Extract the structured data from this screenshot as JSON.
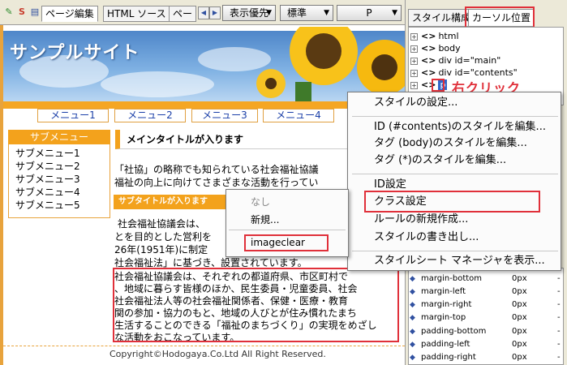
{
  "toolbar": {
    "icons": [
      "pencil-icon",
      "s-icon",
      "document-icon"
    ],
    "tabs": [
      "ページ編集",
      "HTML ソース",
      "ペー"
    ],
    "dropdowns": [
      "表示優先",
      "標準",
      "P"
    ]
  },
  "page": {
    "site_title": "サンプルサイト",
    "menus": [
      "メニュー1",
      "メニュー2",
      "メニュー3",
      "メニュー4"
    ],
    "submenu_title": "サブメニュー",
    "submenu_items": [
      "サブメニュー1",
      "サブメニュー2",
      "サブメニュー3",
      "サブメニュー4",
      "サブメニュー5"
    ],
    "main_title": "メインタイトルが入ります",
    "intro_lines": [
      "「社協」の略称でも知られている社会福祉協議",
      "福祉の向上に向けてさまざまな活動を行ってい"
    ],
    "subtitle": "サブタイトルが入ります",
    "para1": [
      "社会福祉協議会は、",
      "とを目的とした営利を",
      "26年(1951年)に制定",
      "社会福祉法」に基づき、設置されています。"
    ],
    "para2": [
      "社会福祉協議会は、それぞれの都道府県、市区町村で",
      "、地域に暮らす皆様のほか、民生委員・児童委員、社会",
      "社会福祉法人等の社会福祉関係者、保健・医療・教育",
      "関の参加・協力のもと、地域の人びとが住み慣れたまち",
      "生活することのできる「福祉のまちづくり」の実現をめざし",
      "な活動をおこなっています。"
    ],
    "copyright": "Copyright©Hodogaya.Co.Ltd All Right Reserved."
  },
  "panel": {
    "tabs": [
      "スタイル構成",
      "カーソル位置"
    ],
    "tree": [
      "html",
      "body",
      "div id=\"main\"",
      "div id=\"contents\"",
      "p"
    ],
    "annotation": "右クリック",
    "properties": [
      {
        "name": "margin-bottom",
        "value": "0px"
      },
      {
        "name": "margin-left",
        "value": "0px"
      },
      {
        "name": "margin-right",
        "value": "0px"
      },
      {
        "name": "margin-top",
        "value": "0px"
      },
      {
        "name": "padding-bottom",
        "value": "0px"
      },
      {
        "name": "padding-left",
        "value": "0px"
      },
      {
        "name": "padding-right",
        "value": "0px"
      }
    ]
  },
  "context_menu": {
    "items": [
      "スタイルの設定...",
      "ID (#contents)のスタイルを編集...",
      "タグ (body)のスタイルを編集...",
      "タグ (*)のスタイルを編集...",
      "ID設定",
      "クラス設定",
      "ルールの新規作成...",
      "スタイルの書き出し...",
      "スタイルシート マネージャを表示..."
    ]
  },
  "class_submenu": {
    "items": [
      "なし",
      "新規...",
      "imageclear"
    ]
  },
  "colors": {
    "accent_orange": "#f3a21c",
    "highlight_red": "#e0303a",
    "link_blue": "#1a3fa8"
  }
}
